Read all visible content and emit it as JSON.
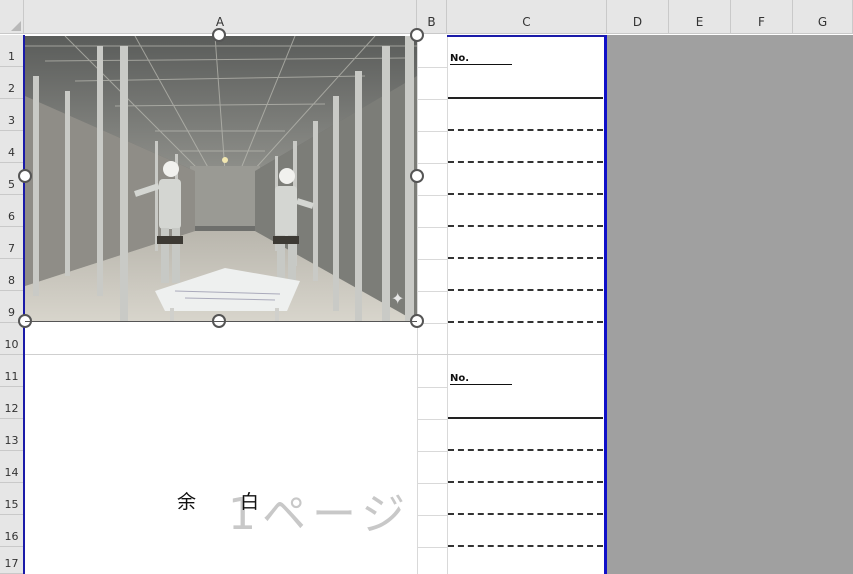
{
  "columns": [
    {
      "label": "A"
    },
    {
      "label": "B"
    },
    {
      "label": "C"
    },
    {
      "label": "D"
    },
    {
      "label": "E"
    },
    {
      "label": "F"
    },
    {
      "label": "G"
    }
  ],
  "rows": [
    "1",
    "2",
    "3",
    "4",
    "5",
    "6",
    "7",
    "8",
    "9",
    "10",
    "11",
    "12",
    "13",
    "14",
    "15",
    "16",
    "17"
  ],
  "cells": {
    "no_label_1": "No.",
    "no_label_2": "No.",
    "yohaku_left": "余",
    "yohaku_right": "白"
  },
  "watermark": {
    "page_number": "1",
    "page_text": "ページ"
  },
  "picture": {
    "description_icon": "construction-photo"
  },
  "colors": {
    "page_break": "#1010c8",
    "outside_print_area": "#a0a0a0"
  }
}
